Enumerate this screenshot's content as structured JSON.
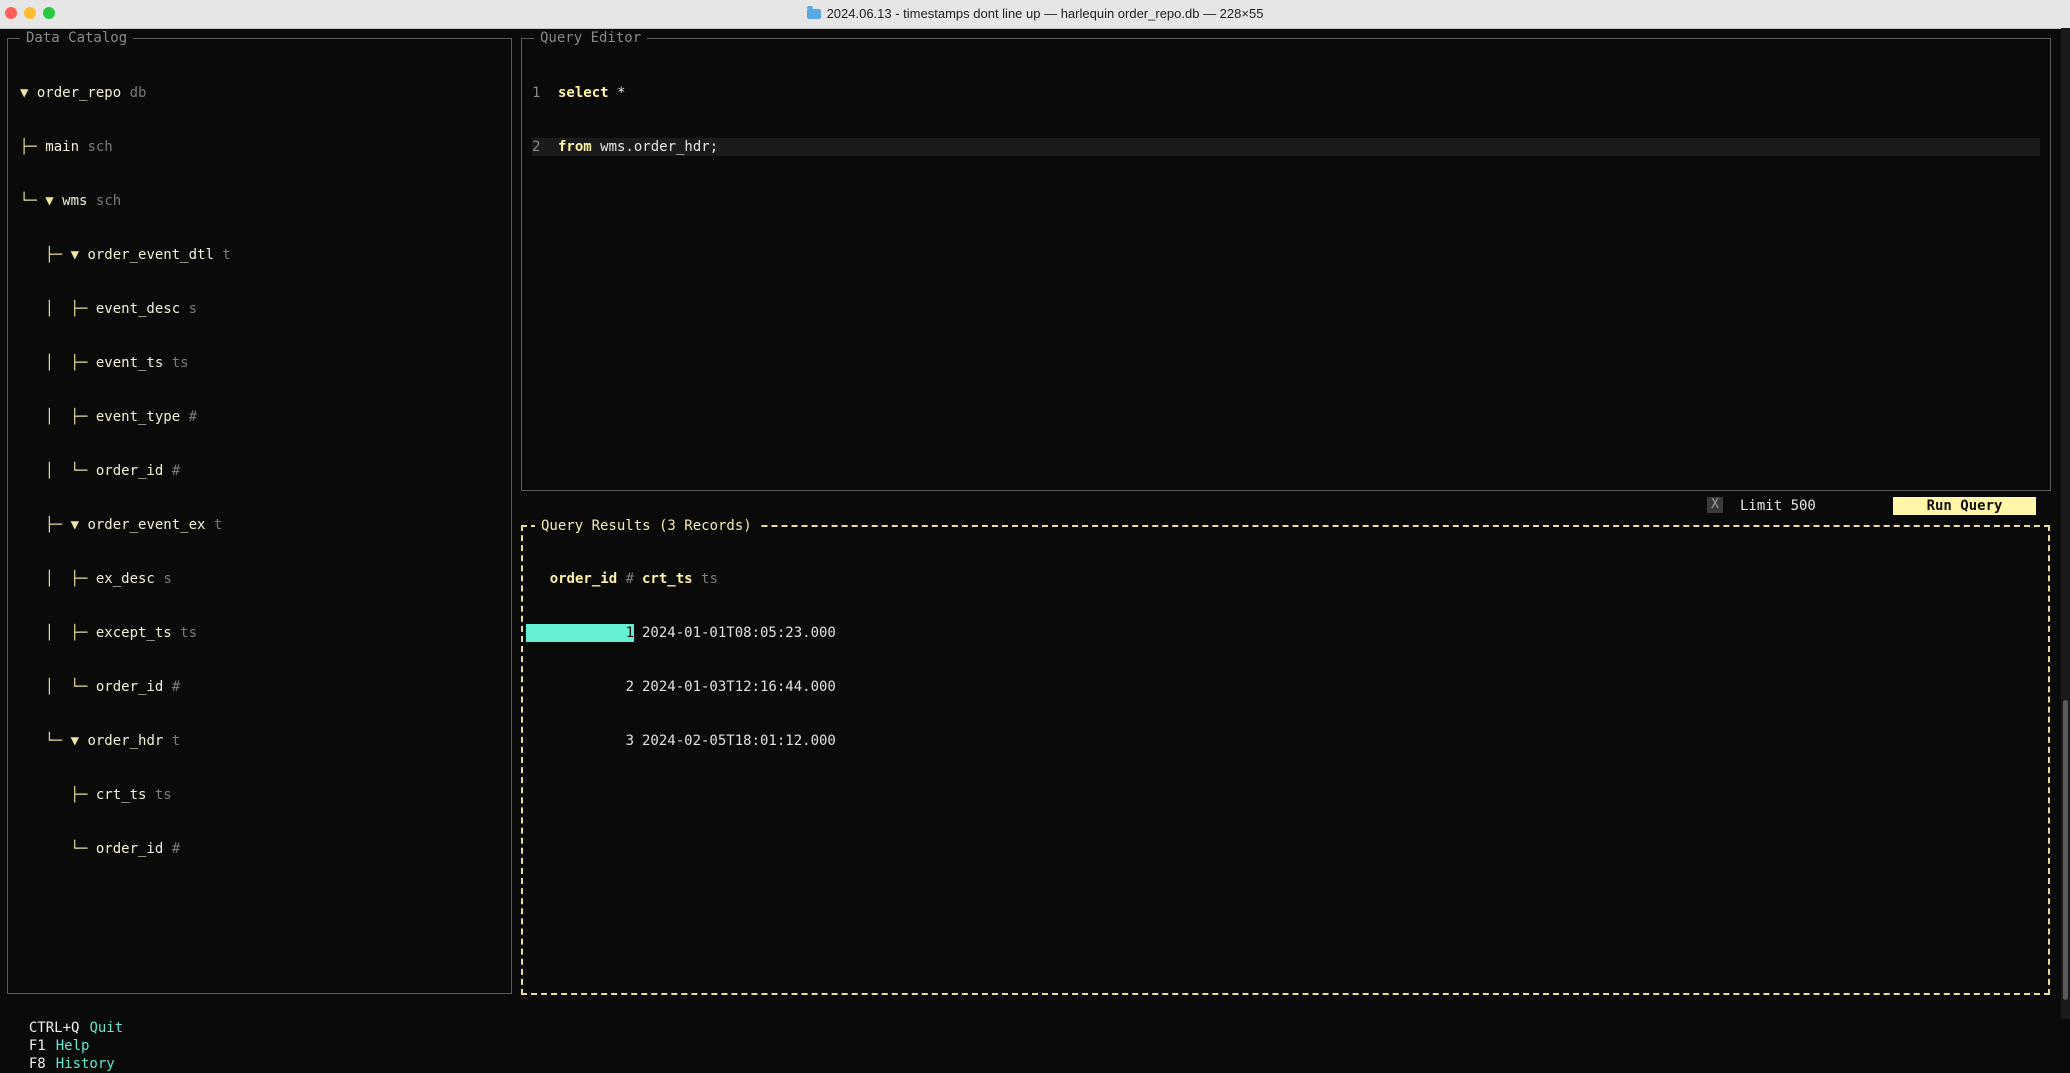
{
  "window": {
    "title": "2024.06.13 - timestamps dont line up — harlequin order_repo.db — 228×55"
  },
  "catalog": {
    "title": "Data Catalog",
    "tree": [
      {
        "prefix": "▼ ",
        "name": "order_repo",
        "type": "db"
      },
      {
        "prefix": "├─ ",
        "name": "main",
        "type": "sch"
      },
      {
        "prefix": "└─ ▼ ",
        "name": "wms",
        "type": "sch"
      },
      {
        "prefix": "   ├─ ▼ ",
        "name": "order_event_dtl",
        "type": "t"
      },
      {
        "prefix": "   │  ├─ ",
        "name": "event_desc",
        "type": "s"
      },
      {
        "prefix": "   │  ├─ ",
        "name": "event_ts",
        "type": "ts"
      },
      {
        "prefix": "   │  ├─ ",
        "name": "event_type",
        "type": "#"
      },
      {
        "prefix": "   │  └─ ",
        "name": "order_id",
        "type": "#"
      },
      {
        "prefix": "   ├─ ▼ ",
        "name": "order_event_ex",
        "type": "t"
      },
      {
        "prefix": "   │  ├─ ",
        "name": "ex_desc",
        "type": "s"
      },
      {
        "prefix": "   │  ├─ ",
        "name": "except_ts",
        "type": "ts"
      },
      {
        "prefix": "   │  └─ ",
        "name": "order_id",
        "type": "#"
      },
      {
        "prefix": "   └─ ▼ ",
        "name": "order_hdr",
        "type": "t"
      },
      {
        "prefix": "      ├─ ",
        "name": "crt_ts",
        "type": "ts"
      },
      {
        "prefix": "      └─ ",
        "name": "order_id",
        "type": "#"
      }
    ]
  },
  "editor": {
    "title": "Query Editor",
    "lines": [
      {
        "num": "1",
        "kw": "select",
        "rest": " *"
      },
      {
        "num": "2",
        "kw": "from",
        "rest": " wms.order_hdr;"
      }
    ]
  },
  "controls": {
    "limit_checkbox_mark": "X",
    "limit_label": "Limit 500",
    "run_label": "Run Query"
  },
  "results": {
    "title": "Query Results (3 Records)",
    "columns": [
      {
        "name": "order_id",
        "type": "#"
      },
      {
        "name": "crt_ts",
        "type": "ts"
      }
    ],
    "rows": [
      [
        "1",
        "2024-01-01T08:05:23.000"
      ],
      [
        "2",
        "2024-01-03T12:16:44.000"
      ],
      [
        "3",
        "2024-02-05T18:01:12.000"
      ]
    ]
  },
  "footer": [
    {
      "key": "CTRL+Q",
      "label": "Quit"
    },
    {
      "key": "F1",
      "label": "Help"
    },
    {
      "key": "F8",
      "label": "History"
    }
  ],
  "colors": {
    "accent": "#fff3a8",
    "selection": "#66f0d2",
    "background": "#0a0a0a"
  }
}
